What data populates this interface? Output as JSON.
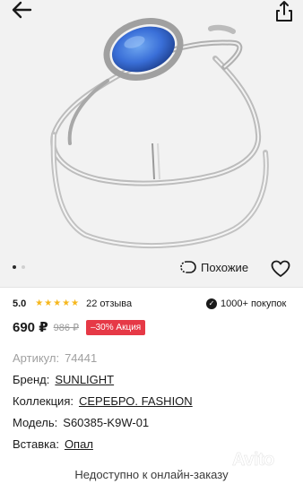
{
  "gallery": {
    "dots_total": 2,
    "active_dot": 0
  },
  "actions": {
    "similar_label": "Похожие"
  },
  "rating": {
    "value": "5.0",
    "stars": 5,
    "reviews": "22 отзыва"
  },
  "buyers": {
    "label": "1000+ покупок"
  },
  "price": {
    "current": "690 ₽",
    "old": "986 ₽",
    "promo": "–30% Акция"
  },
  "attributes": [
    {
      "label": "Артикул:",
      "value": "74441",
      "link": false,
      "muted": true
    },
    {
      "label": "Бренд:",
      "value": "SUNLIGHT",
      "link": true,
      "muted": false
    },
    {
      "label": "Коллекция:",
      "value": "СЕРЕБРО. FASHION",
      "link": true,
      "muted": false
    },
    {
      "label": "Модель:",
      "value": "S60385-K9W-01",
      "link": false,
      "muted": false
    },
    {
      "label": "Вставка:",
      "value": "Опал",
      "link": true,
      "muted": false
    }
  ],
  "footer": {
    "unavailable": "Недоступно к онлайн-заказу"
  },
  "watermark": {
    "text": "Avito"
  },
  "colors": {
    "promo": "#e63946",
    "star": "#f6b71c",
    "opal": "#3a6fd8"
  }
}
